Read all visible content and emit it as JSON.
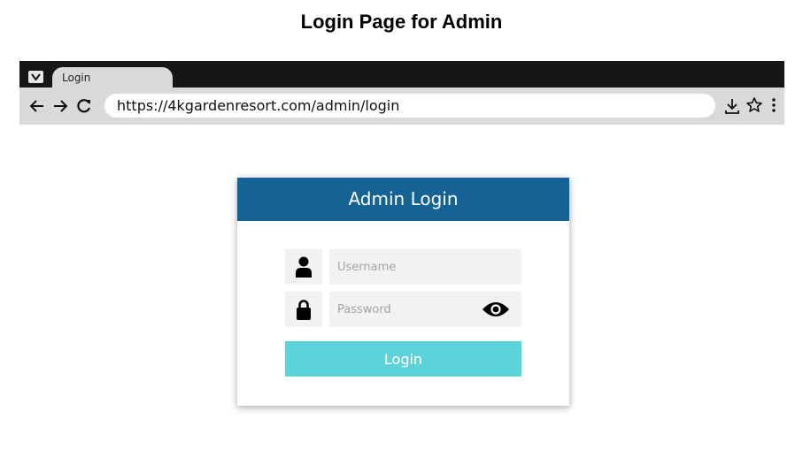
{
  "page": {
    "title": "Login Page for Admin"
  },
  "browser": {
    "tab_label": "Login",
    "url": "https://4kgardenresort.com/admin/login",
    "icons": [
      "menu-chevron-icon",
      "back-arrow-icon",
      "forward-arrow-icon",
      "reload-icon",
      "download-icon",
      "star-icon",
      "kebab-menu-icon"
    ]
  },
  "login_card": {
    "header": "Admin Login",
    "header_color": "#146394",
    "username_placeholder": "Username",
    "password_placeholder": "Password",
    "button_label": "Login",
    "button_color": "#5cd2d9",
    "icons": [
      "user-icon",
      "lock-icon",
      "eye-icon"
    ]
  }
}
